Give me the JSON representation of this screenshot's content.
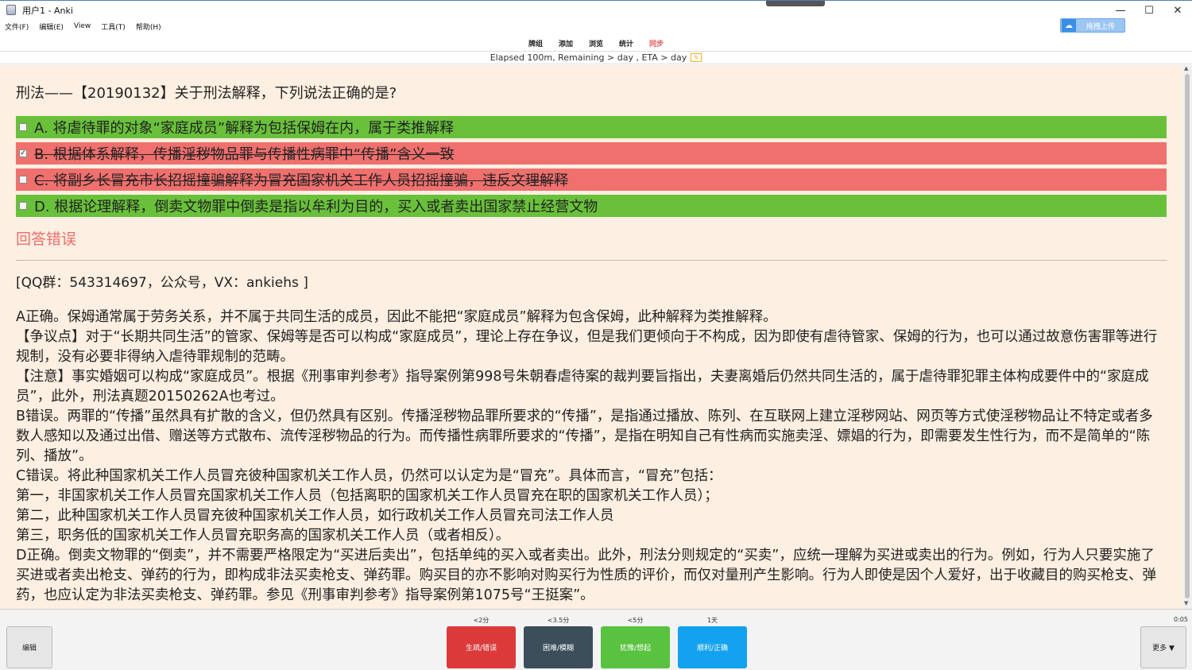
{
  "window": {
    "title": "用户1 - Anki"
  },
  "upload_button": {
    "label": "拖拽上传"
  },
  "menu": [
    "文件(F)",
    "编辑(E)",
    "View",
    "工具(T)",
    "帮助(H)"
  ],
  "toolbar": [
    "牌组",
    "添加",
    "浏览",
    "统计",
    "同步"
  ],
  "progress": {
    "text": "Elapsed 100m, Remaining > day , ETA > day"
  },
  "card": {
    "question": "刑法——【20190132】关于刑法解释，下列说法正确的是?",
    "options": [
      {
        "text": "A. 将虐待罪的对象“家庭成员”解释为包括保姆在内，属于类推解释",
        "status": "correct",
        "checked": false
      },
      {
        "text": "B. 根据体系解释，传播淫秽物品罪与传播性病罪中“传播”含义一致",
        "status": "wrong",
        "checked": true
      },
      {
        "text": "C. 将副乡长冒充市长招摇撞骗解释为冒充国家机关工作人员招摇撞骗，违反文理解释",
        "status": "wrong",
        "checked": false
      },
      {
        "text": "D. 根据论理解释，倒卖文物罪中倒卖是指以牟利为目的，买入或者卖出国家禁止经营文物",
        "status": "correct",
        "checked": false
      }
    ],
    "result": "回答错误",
    "qq": "[QQ群：543314697，公众号，VX：ankiehs ]",
    "explanation": [
      "A正确。保姆通常属于劳务关系，并不属于共同生活的成员，因此不能把“家庭成员”解释为包含保姆，此种解释为类推解释。",
      "【争议点】对于“长期共同生活”的管家、保姆等是否可以构成“家庭成员”，理论上存在争议，但是我们更倾向于不构成，因为即使有虐待管家、保姆的行为，也可以通过故意伤害罪等进行规制，没有必要非得纳入虐待罪规制的范畴。",
      "【注意】事实婚姻可以构成“家庭成员”。根据《刑事审判参考》指导案例第998号朱朝春虐待案的裁判要旨指出，夫妻离婚后仍然共同生活的，属于虐待罪犯罪主体构成要件中的“家庭成员”，此外，刑法真题20150262A也考过。",
      "B错误。两罪的“传播”虽然具有扩散的含义，但仍然具有区别。传播淫秽物品罪所要求的“传播”，是指通过播放、陈列、在互联网上建立淫秽网站、网页等方式使淫秽物品让不特定或者多数人感知以及通过出借、赠送等方式散布、流传淫秽物品的行为。而传播性病罪所要求的“传播”，是指在明知自己有性病而实施卖淫、嫖娼的行为，即需要发生性行为，而不是简单的“陈列、播放”。",
      "C错误。将此种国家机关工作人员冒充彼种国家机关工作人员，仍然可以认定为是“冒充”。具体而言，“冒充”包括：",
      "第一，非国家机关工作人员冒充国家机关工作人员（包括离职的国家机关工作人员冒充在职的国家机关工作人员）；",
      "第二，此种国家机关工作人员冒充彼种国家机关工作人员，如行政机关工作人员冒充司法工作人员",
      "第三，职务低的国家机关工作人员冒充职务高的国家机关工作人员（或者相反）。",
      "D正确。倒卖文物罪的“倒卖”，并不需要严格限定为“买进后卖出”，包括单纯的买入或者卖出。此外，刑法分则规定的“买卖”，应统一理解为买进或卖出的行为。例如，行为人只要实施了买进或者卖出枪支、弹药的行为，即构成非法买卖枪支、弹药罪。购买目的亦不影响对购买行为性质的评价，而仅对量刑产生影响。行为人即使是因个人爱好，出于收藏目的购买枪支、弹药，也应认定为非法买卖枪支、弹药罪。参见《刑事审判参考》指导案例第1075号“王挺案”。"
    ]
  },
  "bottom": {
    "edit": "编辑",
    "more": "更多 ▼",
    "timer": "0:05",
    "answers": [
      {
        "interval": "<2分",
        "label": "生疏/错误",
        "color": "#dc3a3a"
      },
      {
        "interval": "<3.5分",
        "label": "困难/模糊",
        "color": "#3c4e5a"
      },
      {
        "interval": "<5分",
        "label": "犹豫/想起",
        "color": "#59c23f"
      },
      {
        "interval": "1天",
        "label": "顺利/正确",
        "color": "#13a2f0"
      }
    ]
  }
}
